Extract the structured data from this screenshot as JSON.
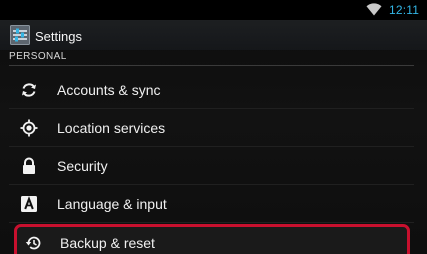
{
  "status_bar": {
    "time": "12:11",
    "wifi_icon": "wifi-icon",
    "accent_color": "#33b5e5"
  },
  "action_bar": {
    "app_icon": "settings-app-icon",
    "title": "Settings"
  },
  "section": {
    "header": "PERSONAL"
  },
  "list": {
    "items": [
      {
        "label": "Accounts & sync",
        "icon": "sync-icon"
      },
      {
        "label": "Location services",
        "icon": "location-icon"
      },
      {
        "label": "Security",
        "icon": "lock-icon"
      },
      {
        "label": "Language & input",
        "icon": "keyboard-a-icon"
      },
      {
        "label": "Backup & reset",
        "icon": "backup-restore-icon",
        "highlighted": true
      }
    ]
  },
  "colors": {
    "highlight_border": "#c8102e",
    "background": "#0e0e0e"
  }
}
